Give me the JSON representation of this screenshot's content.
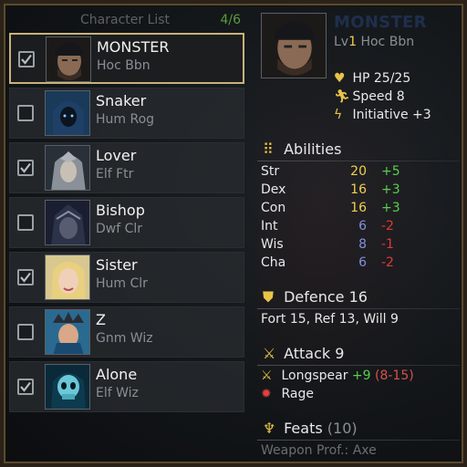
{
  "list": {
    "title": "Character List",
    "count": "4/6"
  },
  "characters": [
    {
      "name": "MONSTER",
      "sub": "Hoc Bbn",
      "checked": true,
      "selected": true
    },
    {
      "name": "Snaker",
      "sub": "Hum Rog",
      "checked": false,
      "selected": false
    },
    {
      "name": "Lover",
      "sub": "Elf Ftr",
      "checked": true,
      "selected": false
    },
    {
      "name": "Bishop",
      "sub": "Dwf Clr",
      "checked": false,
      "selected": false
    },
    {
      "name": "Sister",
      "sub": "Hum Clr",
      "checked": true,
      "selected": false
    },
    {
      "name": "Z",
      "sub": "Gnm Wiz",
      "checked": false,
      "selected": false
    },
    {
      "name": "Alone",
      "sub": "Elf Wiz",
      "checked": true,
      "selected": false
    }
  ],
  "detail": {
    "name": "MONSTER",
    "lv_prefix": "Lv",
    "level": "1",
    "class": "Hoc Bbn",
    "hp_label": "HP",
    "hp": "25/25",
    "speed_label": "Speed",
    "speed": "8",
    "initiative_label": "Initiative",
    "initiative": "+3"
  },
  "abilities": {
    "title": "Abilities",
    "rows": [
      {
        "name": "Str",
        "value": "20",
        "mod": "+5",
        "value_color": "#f0d050",
        "mod_color": "#58d048"
      },
      {
        "name": "Dex",
        "value": "16",
        "mod": "+3",
        "value_color": "#f0d050",
        "mod_color": "#58d048"
      },
      {
        "name": "Con",
        "value": "16",
        "mod": "+3",
        "value_color": "#f0d050",
        "mod_color": "#58d048"
      },
      {
        "name": "Int",
        "value": "6",
        "mod": "-2",
        "value_color": "#8090e0",
        "mod_color": "#e03838"
      },
      {
        "name": "Wis",
        "value": "8",
        "mod": "-1",
        "value_color": "#8090e0",
        "mod_color": "#e03838"
      },
      {
        "name": "Cha",
        "value": "6",
        "mod": "-2",
        "value_color": "#8090e0",
        "mod_color": "#e03838"
      }
    ]
  },
  "defence": {
    "title": "Defence",
    "value": "16",
    "fort_label": "Fort",
    "fort": "15,",
    "ref_label": "Ref",
    "ref": "13,",
    "will_label": "Will",
    "will": "9"
  },
  "attack": {
    "title": "Attack",
    "value": "9",
    "weapon": "Longspear",
    "weapon_bonus": "+9",
    "weapon_damage": "(8-15)",
    "ability": "Rage"
  },
  "feats": {
    "title": "Feats",
    "count": "(10)",
    "first": "Weapon Prof.: Axe"
  },
  "icons": {
    "hp": "heart-icon",
    "speed": "running-man-icon",
    "initiative": "lightning-icon",
    "abilities": "grid-icon",
    "defence": "shield-icon",
    "attack": "crossed-swords-icon",
    "weapon": "sword-icon",
    "rage": "rage-icon",
    "feats": "trophy-icon"
  }
}
